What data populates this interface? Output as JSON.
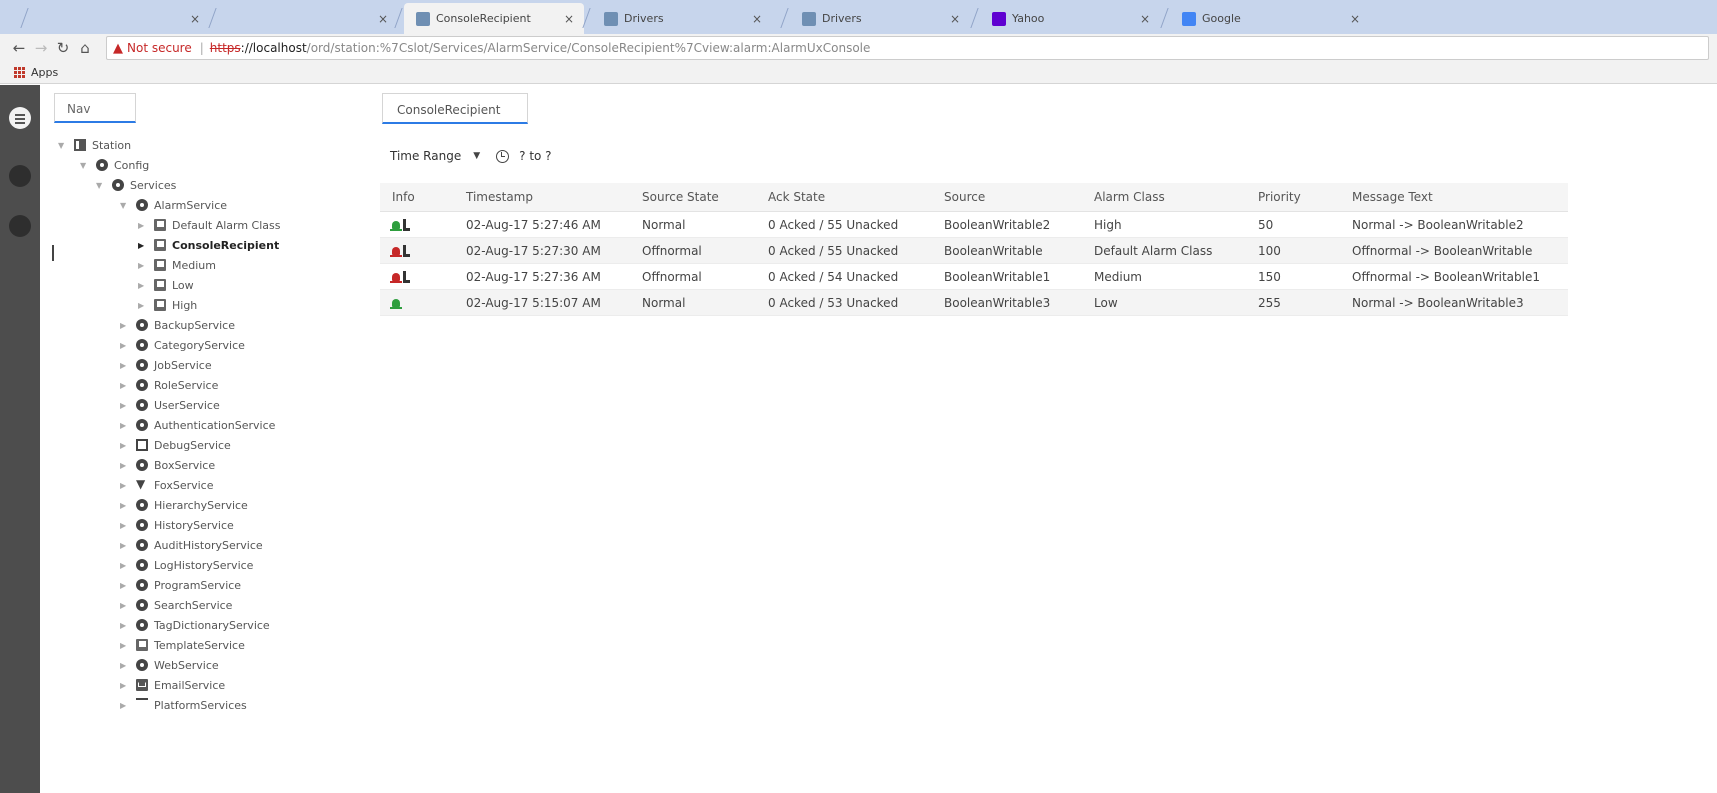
{
  "browser": {
    "tabs": [
      {
        "label": "",
        "active": false,
        "icon": "blank"
      },
      {
        "label": "",
        "active": false,
        "icon": "blank"
      },
      {
        "label": "ConsoleRecipient",
        "active": true,
        "icon": "niagara-icon"
      },
      {
        "label": "Drivers",
        "active": false,
        "icon": "niagara-icon"
      },
      {
        "label": "Drivers",
        "active": false,
        "icon": "niagara-icon"
      },
      {
        "label": "Yahoo",
        "active": false,
        "icon": "yahoo-icon"
      },
      {
        "label": "Google",
        "active": false,
        "icon": "google-icon"
      }
    ],
    "close_glyph": "×",
    "not_secure_label": "Not secure",
    "url_scheme": "https",
    "url_host": "://localhost",
    "url_path": "/ord/station:%7Cslot/Services/AlarmService/ConsoleRecipient%7Cview:alarm:AlarmUxConsole",
    "bookmarks_apps_label": "Apps"
  },
  "sidebar": {
    "tab_label": "Nav",
    "tree": [
      {
        "label": "Station",
        "depth": 0,
        "icon": "station-icon",
        "expanded": true
      },
      {
        "label": "Config",
        "depth": 1,
        "icon": "config-icon",
        "expanded": true
      },
      {
        "label": "Services",
        "depth": 2,
        "icon": "services-icon",
        "expanded": true
      },
      {
        "label": "AlarmService",
        "depth": 3,
        "icon": "alarm-service-icon",
        "expanded": true
      },
      {
        "label": "Default Alarm Class",
        "depth": 4,
        "icon": "alarm-class-icon"
      },
      {
        "label": "ConsoleRecipient",
        "depth": 4,
        "icon": "console-recipient-icon",
        "selected": true
      },
      {
        "label": "Medium",
        "depth": 4,
        "icon": "alarm-class-icon"
      },
      {
        "label": "Low",
        "depth": 4,
        "icon": "alarm-class-icon"
      },
      {
        "label": "High",
        "depth": 4,
        "icon": "alarm-class-icon"
      },
      {
        "label": "BackupService",
        "depth": 3,
        "icon": "backup-service-icon"
      },
      {
        "label": "CategoryService",
        "depth": 3,
        "icon": "category-service-icon"
      },
      {
        "label": "JobService",
        "depth": 3,
        "icon": "job-service-icon"
      },
      {
        "label": "RoleService",
        "depth": 3,
        "icon": "role-service-icon"
      },
      {
        "label": "UserService",
        "depth": 3,
        "icon": "user-service-icon"
      },
      {
        "label": "AuthenticationService",
        "depth": 3,
        "icon": "authentication-service-icon"
      },
      {
        "label": "DebugService",
        "depth": 3,
        "icon": "debug-service-icon"
      },
      {
        "label": "BoxService",
        "depth": 3,
        "icon": "box-service-icon"
      },
      {
        "label": "FoxService",
        "depth": 3,
        "icon": "fox-service-icon"
      },
      {
        "label": "HierarchyService",
        "depth": 3,
        "icon": "hierarchy-service-icon"
      },
      {
        "label": "HistoryService",
        "depth": 3,
        "icon": "history-service-icon"
      },
      {
        "label": "AuditHistoryService",
        "depth": 3,
        "icon": "audit-history-service-icon"
      },
      {
        "label": "LogHistoryService",
        "depth": 3,
        "icon": "log-history-service-icon"
      },
      {
        "label": "ProgramService",
        "depth": 3,
        "icon": "program-service-icon"
      },
      {
        "label": "SearchService",
        "depth": 3,
        "icon": "search-service-icon"
      },
      {
        "label": "TagDictionaryService",
        "depth": 3,
        "icon": "tag-dictionary-service-icon"
      },
      {
        "label": "TemplateService",
        "depth": 3,
        "icon": "template-service-icon"
      },
      {
        "label": "WebService",
        "depth": 3,
        "icon": "web-service-icon"
      },
      {
        "label": "EmailService",
        "depth": 3,
        "icon": "email-service-icon"
      },
      {
        "label": "PlatformServices",
        "depth": 3,
        "icon": "platform-services-icon"
      }
    ]
  },
  "main": {
    "tab_label": "ConsoleRecipient",
    "toolbar": {
      "time_range_label": "Time Range",
      "range_text": "? to ?"
    },
    "table": {
      "columns": [
        "Info",
        "Timestamp",
        "Source State",
        "Ack State",
        "Source",
        "Alarm Class",
        "Priority",
        "Message Text"
      ],
      "rows": [
        {
          "bell_color": "#2e9e3e",
          "acked_icon": true,
          "timestamp": "02-Aug-17 5:27:46 AM",
          "source_state": "Normal",
          "ack_state": "0 Acked / 55 Unacked",
          "source": "BooleanWritable2",
          "alarm_class": "High",
          "priority": "50",
          "message": "Normal -> BooleanWritable2"
        },
        {
          "bell_color": "#c62828",
          "acked_icon": true,
          "timestamp": "02-Aug-17 5:27:30 AM",
          "source_state": "Offnormal",
          "ack_state": "0 Acked / 55 Unacked",
          "source": "BooleanWritable",
          "alarm_class": "Default Alarm Class",
          "priority": "100",
          "message": "Offnormal -> BooleanWritable"
        },
        {
          "bell_color": "#c62828",
          "acked_icon": true,
          "timestamp": "02-Aug-17 5:27:36 AM",
          "source_state": "Offnormal",
          "ack_state": "0 Acked / 54 Unacked",
          "source": "BooleanWritable1",
          "alarm_class": "Medium",
          "priority": "150",
          "message": "Offnormal -> BooleanWritable1"
        },
        {
          "bell_color": "#2e9e3e",
          "acked_icon": false,
          "timestamp": "02-Aug-17 5:15:07 AM",
          "source_state": "Normal",
          "ack_state": "0 Acked / 53 Unacked",
          "source": "BooleanWritable3",
          "alarm_class": "Low",
          "priority": "255",
          "message": "Normal -> BooleanWritable3"
        }
      ]
    }
  }
}
